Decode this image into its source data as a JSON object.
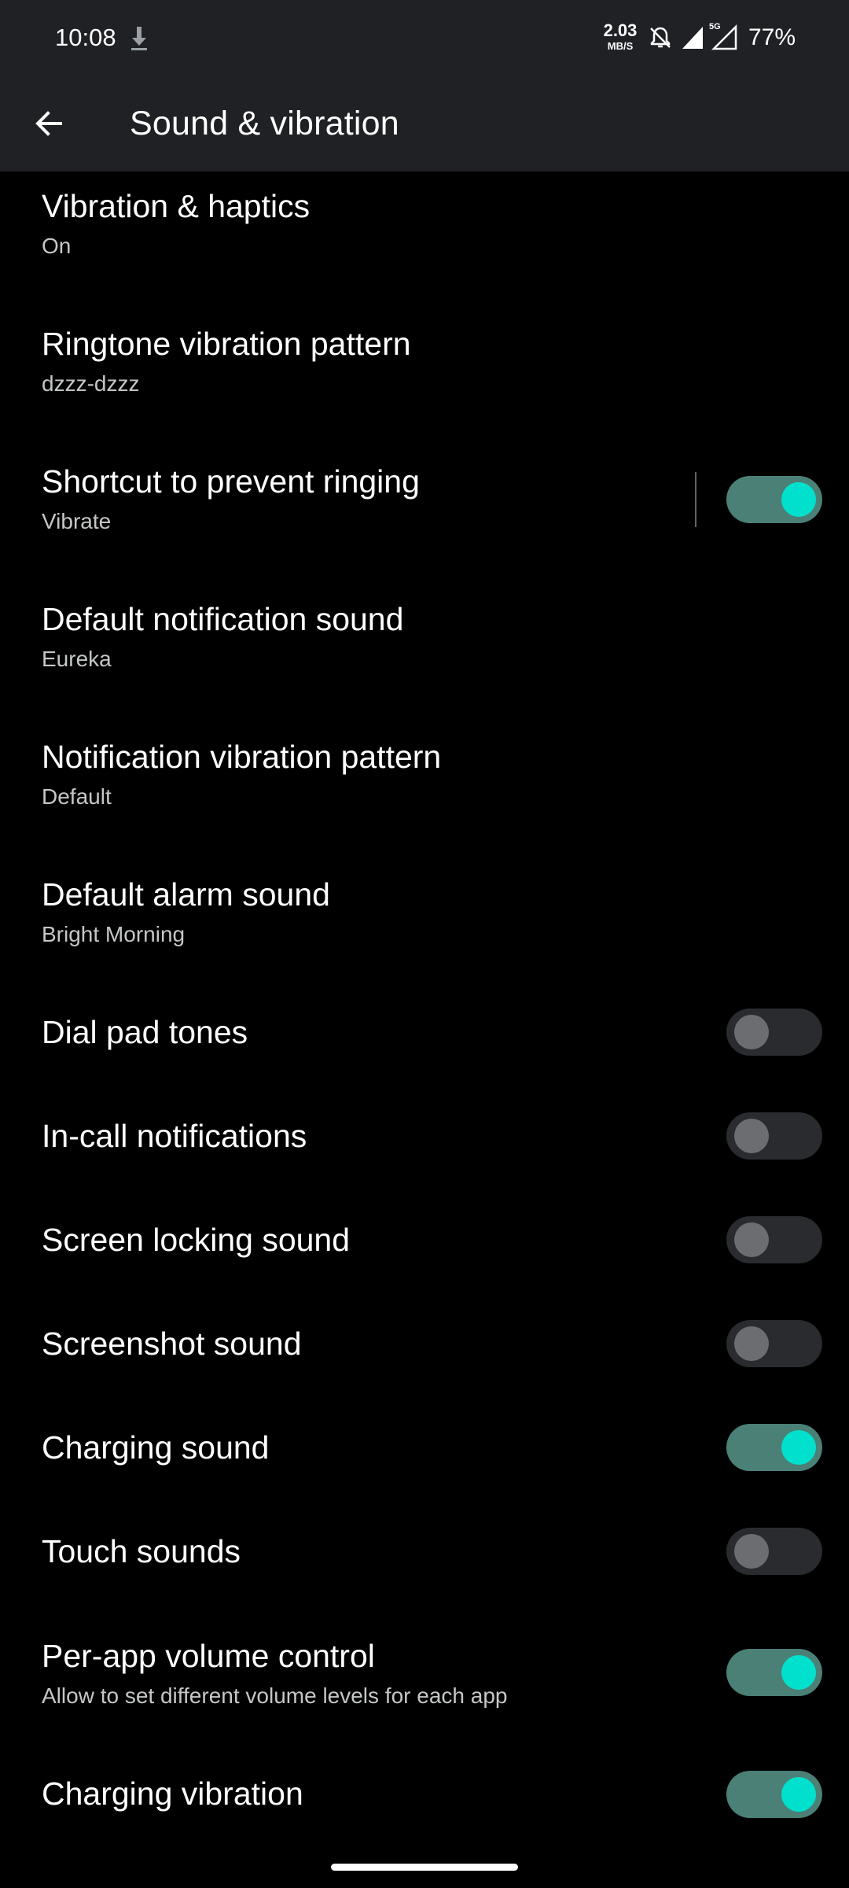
{
  "status_bar": {
    "time": "10:08",
    "speed_value": "2.03",
    "speed_unit": "MB/S",
    "battery": "77%",
    "network_label": "5G",
    "icons": [
      "download-icon",
      "bell-off-icon",
      "signal-icon",
      "signal-5g-icon"
    ]
  },
  "app_bar": {
    "title": "Sound & vibration",
    "back_icon": "arrow-back-icon"
  },
  "colors": {
    "toggle_on_track": "#4b8077",
    "toggle_on_thumb": "#00e0cc",
    "toggle_off_track": "#2a2b2e",
    "toggle_off_thumb": "#6b6d70",
    "background": "#000000",
    "bar": "#202124"
  },
  "settings": [
    {
      "label": "Vibration & haptics",
      "sub": "On"
    },
    {
      "label": "Ringtone vibration pattern",
      "sub": "dzzz-dzzz"
    },
    {
      "label": "Shortcut to prevent ringing",
      "sub": "Vibrate",
      "toggle": true
    },
    {
      "label": "Default notification sound",
      "sub": "Eureka"
    },
    {
      "label": "Notification vibration pattern",
      "sub": "Default"
    },
    {
      "label": "Default alarm sound",
      "sub": "Bright Morning"
    },
    {
      "label": "Dial pad tones",
      "toggle": false
    },
    {
      "label": "In-call notifications",
      "toggle": false
    },
    {
      "label": "Screen locking sound",
      "toggle": false
    },
    {
      "label": "Screenshot sound",
      "toggle": false
    },
    {
      "label": "Charging sound",
      "toggle": true
    },
    {
      "label": "Touch sounds",
      "toggle": false
    },
    {
      "label": "Per-app volume control",
      "sub": "Allow to set different volume levels for each app",
      "toggle": true
    },
    {
      "label": "Charging vibration",
      "toggle": true
    }
  ]
}
